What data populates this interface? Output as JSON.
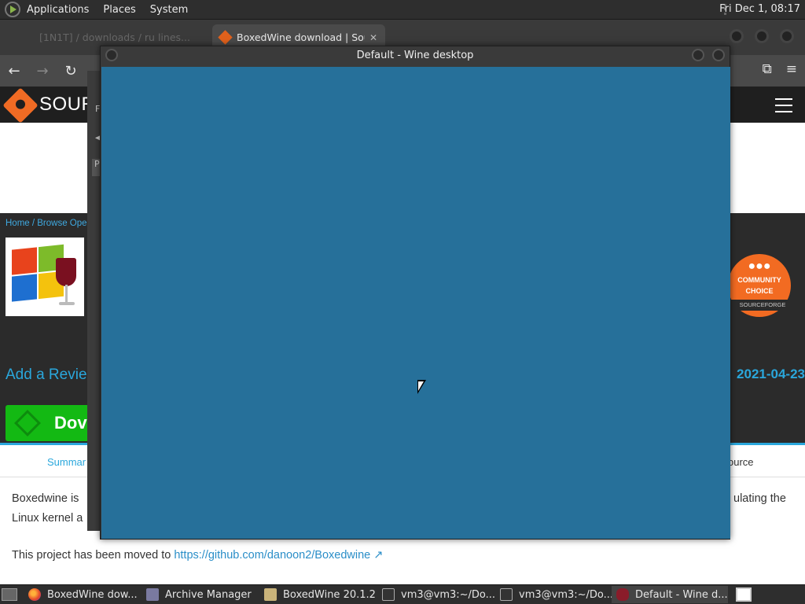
{
  "top_panel": {
    "menus": [
      "Applications",
      "Places",
      "System"
    ],
    "clock": "Fri Dec 1, 08:17"
  },
  "browser": {
    "tabs": [
      {
        "title": "[1N1T] / downloads / ru lines...",
        "active": false
      },
      {
        "title": "BoxedWine download | Sou",
        "active": true
      }
    ],
    "tab_close": "✕",
    "new_tab": "+",
    "nav": {
      "back": "←",
      "forward": "→",
      "reload": "↻"
    },
    "toolbar_right": {
      "extensions": "⧉",
      "menu": "≡"
    }
  },
  "sourceforge": {
    "logo_text": "SOUR",
    "breadcrumb": "Home / Browse Ope",
    "add_review": "Add a Revie",
    "release_date": "2021-04-23",
    "download_label": "Dov",
    "badge": {
      "line1": "COMMUNITY",
      "line2": "CHOICE",
      "brand": "SOURCEFORGE"
    },
    "tabs": {
      "summary": "Summar",
      "source": "ource"
    },
    "desc_line1_left": "Boxedwine is",
    "desc_line1_right": "ulating the",
    "desc_line2_left": "Linux kernel a",
    "moved_text": "This project has been moved to ",
    "moved_link": "https://github.com/danoon2/Boxedwine"
  },
  "mid_window": {
    "frag1": "F",
    "frag2": "◀",
    "frag3": "P"
  },
  "wine_window": {
    "title": "Default - Wine desktop",
    "desktop_color": "#26709a"
  },
  "taskbar": {
    "items": [
      {
        "label": "BoxedWine dow...",
        "icon": "firefox-icon",
        "active": false
      },
      {
        "label": "Archive Manager",
        "icon": "archive-icon",
        "active": false
      },
      {
        "label": "BoxedWine 20.1.2",
        "icon": "folder-icon",
        "active": false
      },
      {
        "label": "vm3@vm3:~/Do...",
        "icon": "terminal-icon",
        "active": false
      },
      {
        "label": "vm3@vm3:~/Do...",
        "icon": "terminal-icon",
        "active": false
      },
      {
        "label": "Default - Wine d...",
        "icon": "wine-icon",
        "active": true
      }
    ]
  },
  "colors": {
    "accent": "#2aa7dc",
    "download_green": "#13b913",
    "sourceforge_orange": "#f26b22"
  }
}
